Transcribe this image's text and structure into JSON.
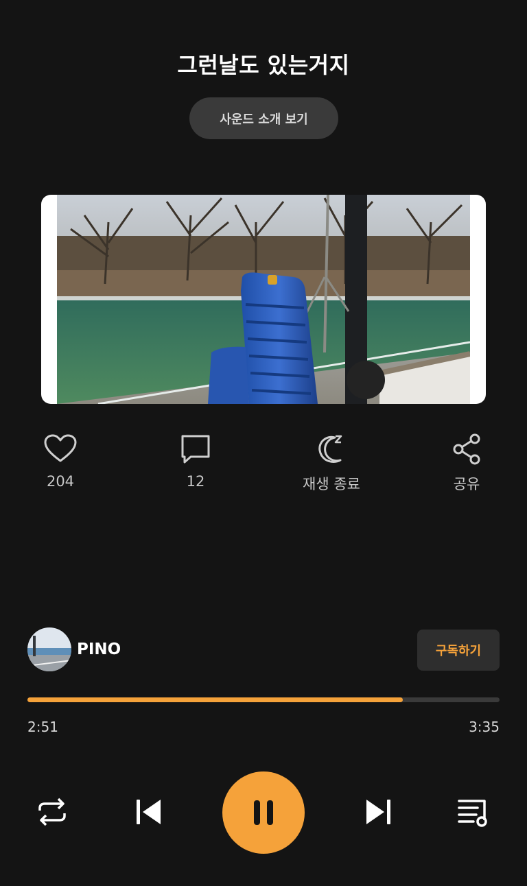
{
  "track": {
    "title": "그런날도 있는거지",
    "intro_button_label": "사운드 소개 보기"
  },
  "actions": {
    "like_count": "204",
    "comment_count": "12",
    "sleep_timer_label": "재생 종료",
    "share_label": "공유"
  },
  "artist": {
    "name": "PINO",
    "subscribe_label": "구독하기"
  },
  "player": {
    "elapsed": "2:51",
    "duration": "3:35",
    "progress_fraction": 0.795
  },
  "colors": {
    "accent": "#f5a23a",
    "background": "#141414"
  }
}
